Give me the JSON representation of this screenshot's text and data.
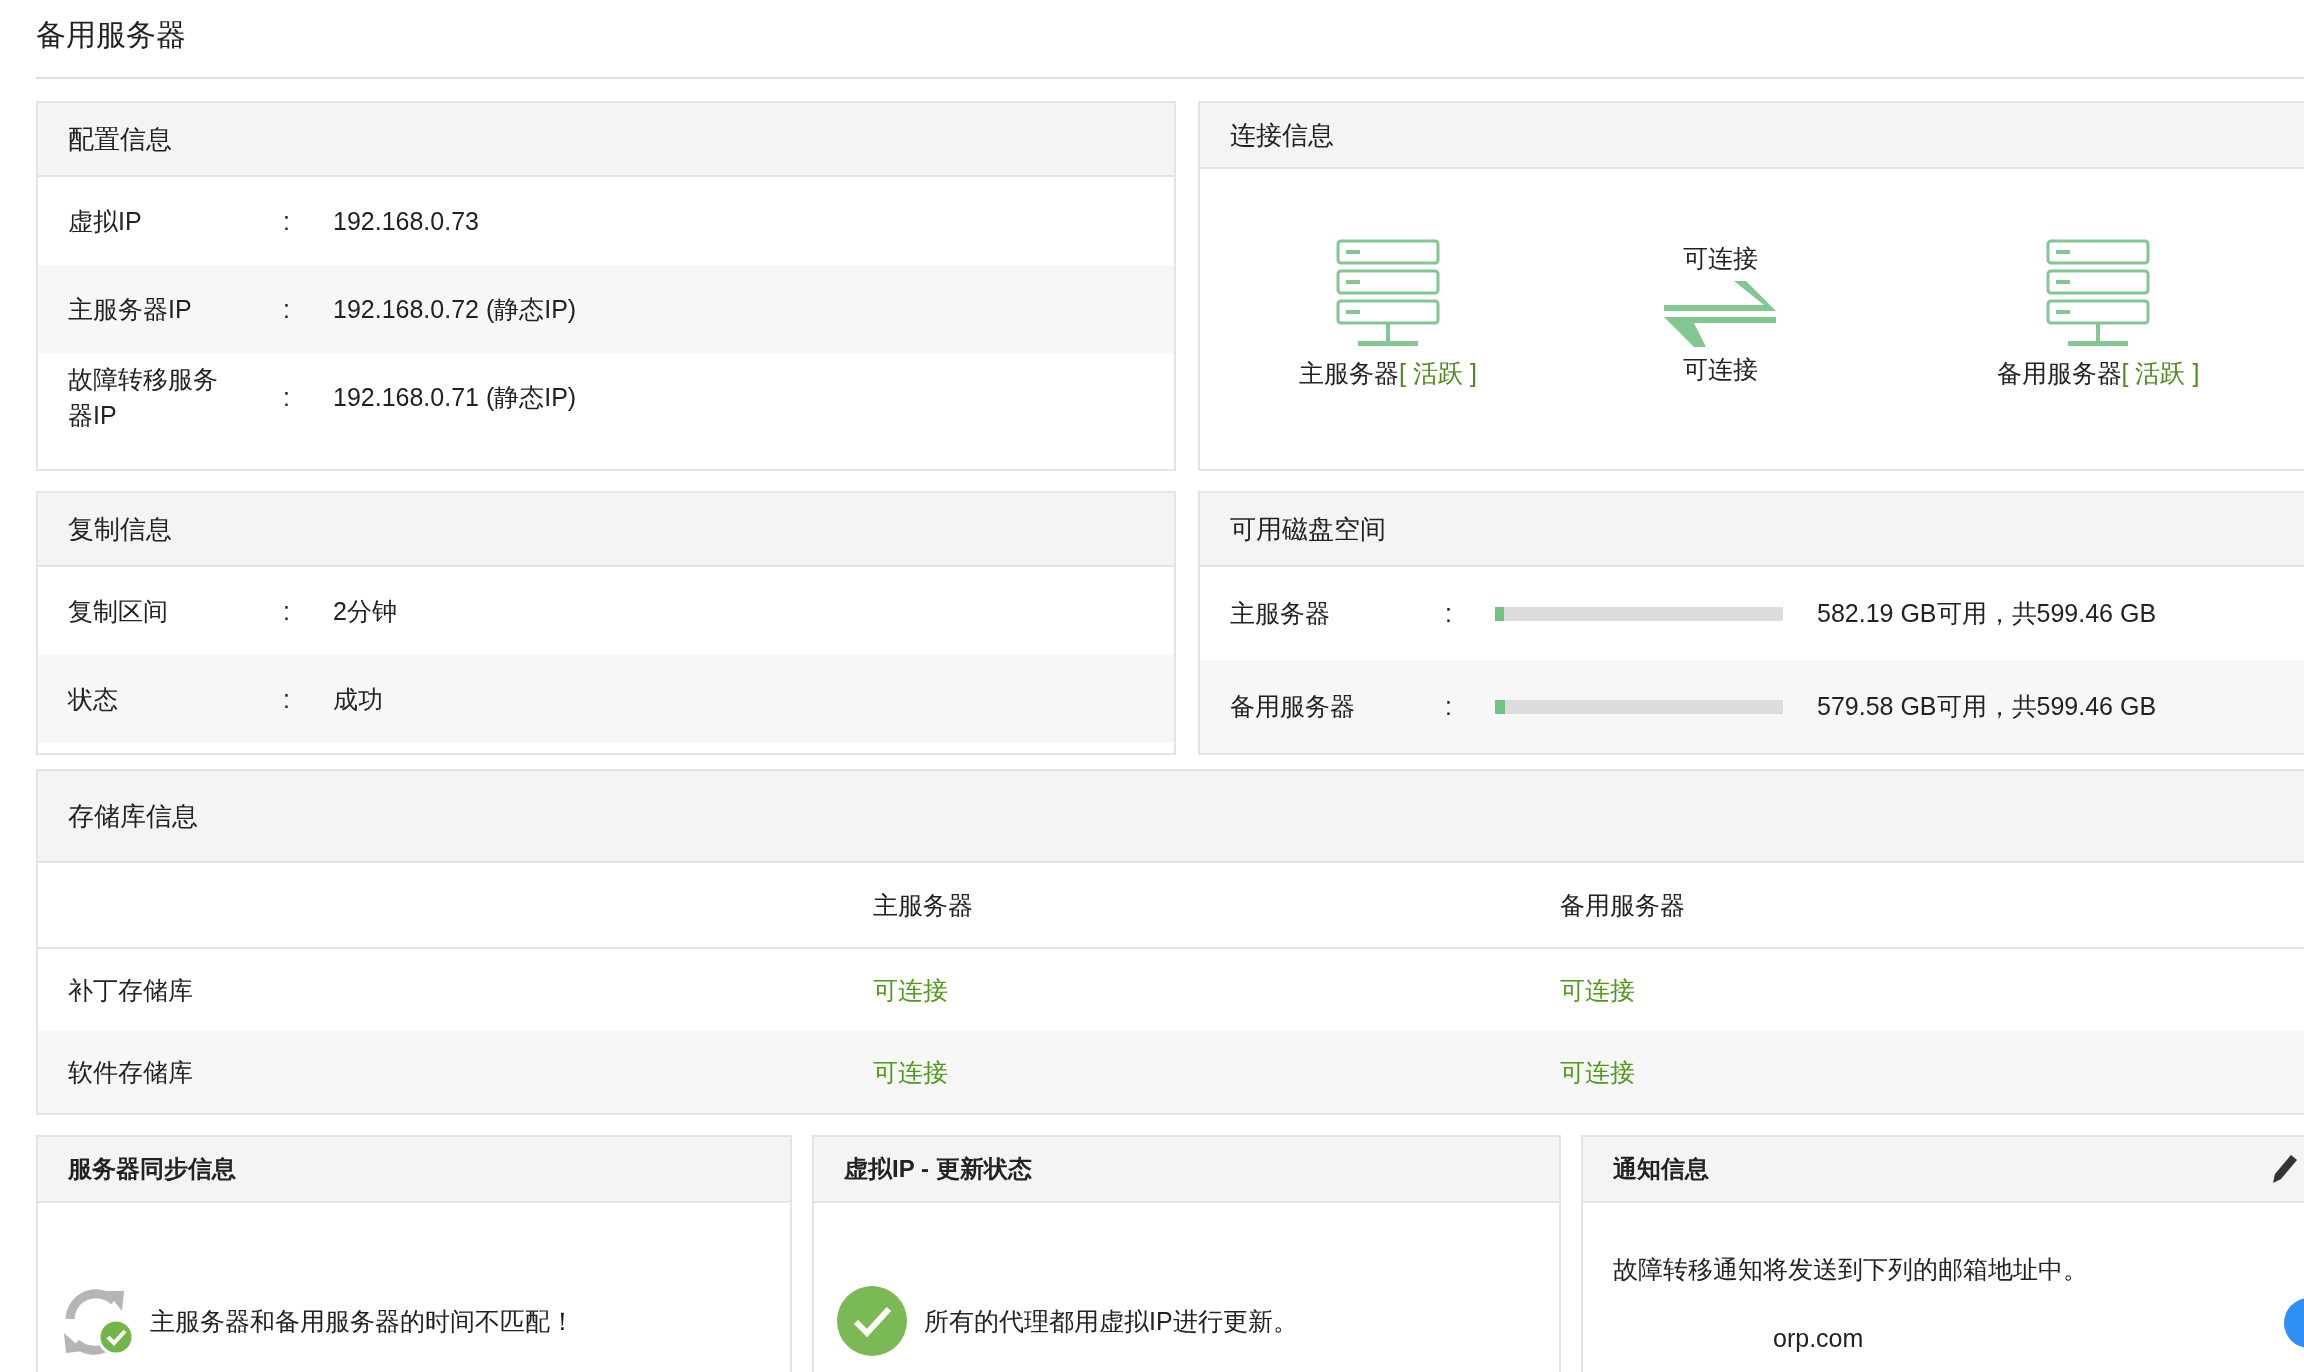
{
  "page_title": "备用服务器",
  "config": {
    "title": "配置信息",
    "rows": [
      {
        "label": "虚拟IP",
        "separator": ":",
        "value": "192.168.0.73"
      },
      {
        "label": "主服务器IP",
        "separator": ":",
        "value": "192.168.0.72 (静态IP)"
      },
      {
        "label": "故障转移服务器IP",
        "separator": ":",
        "value": "192.168.0.71 (静态IP)"
      }
    ]
  },
  "connection": {
    "title": "连接信息",
    "primary": {
      "name": "主服务器",
      "status": "[ 活跃 ]"
    },
    "link_top": "可连接",
    "link_bottom": "可连接",
    "standby": {
      "name": "备用服务器",
      "status": "[ 活跃 ]"
    }
  },
  "replication": {
    "title": "复制信息",
    "rows": [
      {
        "label": "复制区间",
        "separator": ":",
        "value": "2分钟"
      },
      {
        "label": "状态",
        "separator": ":",
        "value": "成功"
      }
    ]
  },
  "disk": {
    "title": "可用磁盘空间",
    "rows": [
      {
        "label": "主服务器",
        "separator": ":",
        "level": 0.03,
        "reading": "582.19 GB可用，共599.46 GB"
      },
      {
        "label": "备用服务器",
        "separator": ":",
        "level": 0.035,
        "reading": "579.58 GB可用，共599.46 GB"
      }
    ]
  },
  "repository": {
    "title": "存储库信息",
    "columns": [
      "主服务器",
      "备用服务器"
    ],
    "rows": [
      {
        "label": "补丁存储库",
        "cells": [
          "可连接",
          "可连接"
        ]
      },
      {
        "label": "软件存储库",
        "cells": [
          "可连接",
          "可连接"
        ]
      }
    ]
  },
  "sync": {
    "title": "服务器同步信息",
    "message": "主服务器和备用服务器的时间不匹配！"
  },
  "vip_update": {
    "title": "虚拟IP - 更新状态",
    "message": "所有的代理都用虚拟IP进行更新。"
  },
  "notification": {
    "title": "通知信息",
    "message": "故障转移通知将发送到下列的邮箱地址中。",
    "email": "orp.com"
  }
}
